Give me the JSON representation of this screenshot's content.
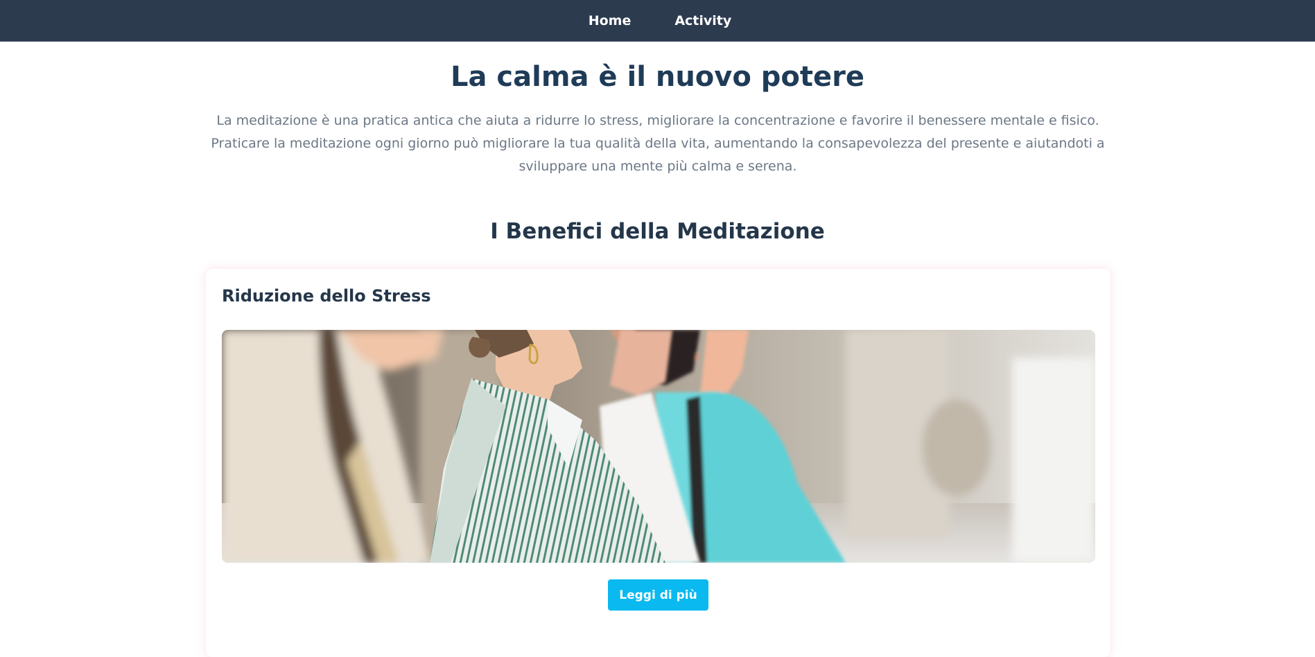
{
  "nav": {
    "items": [
      {
        "label": "Home"
      },
      {
        "label": "Activity"
      }
    ]
  },
  "hero": {
    "title": "La calma è il nuovo potere",
    "text": "La meditazione è una pratica antica che aiuta a ridurre lo stress, migliorare la concentrazione e favorire il benessere mentale e fisico. Praticare la meditazione ogni giorno può migliorare la tua qualità della vita, aumentando la consapevolezza del presente e aiutandoti a sviluppare una mente più calma e serena."
  },
  "benefits": {
    "title": "I Benefici della Meditazione",
    "cards": [
      {
        "title": "Riduzione dello Stress",
        "button_label": "Leggi di più"
      }
    ]
  },
  "colors": {
    "navbar": "#2d3b4f",
    "title": "#1f3b57",
    "text": "#6b7785",
    "button": "#0ab9f0"
  }
}
